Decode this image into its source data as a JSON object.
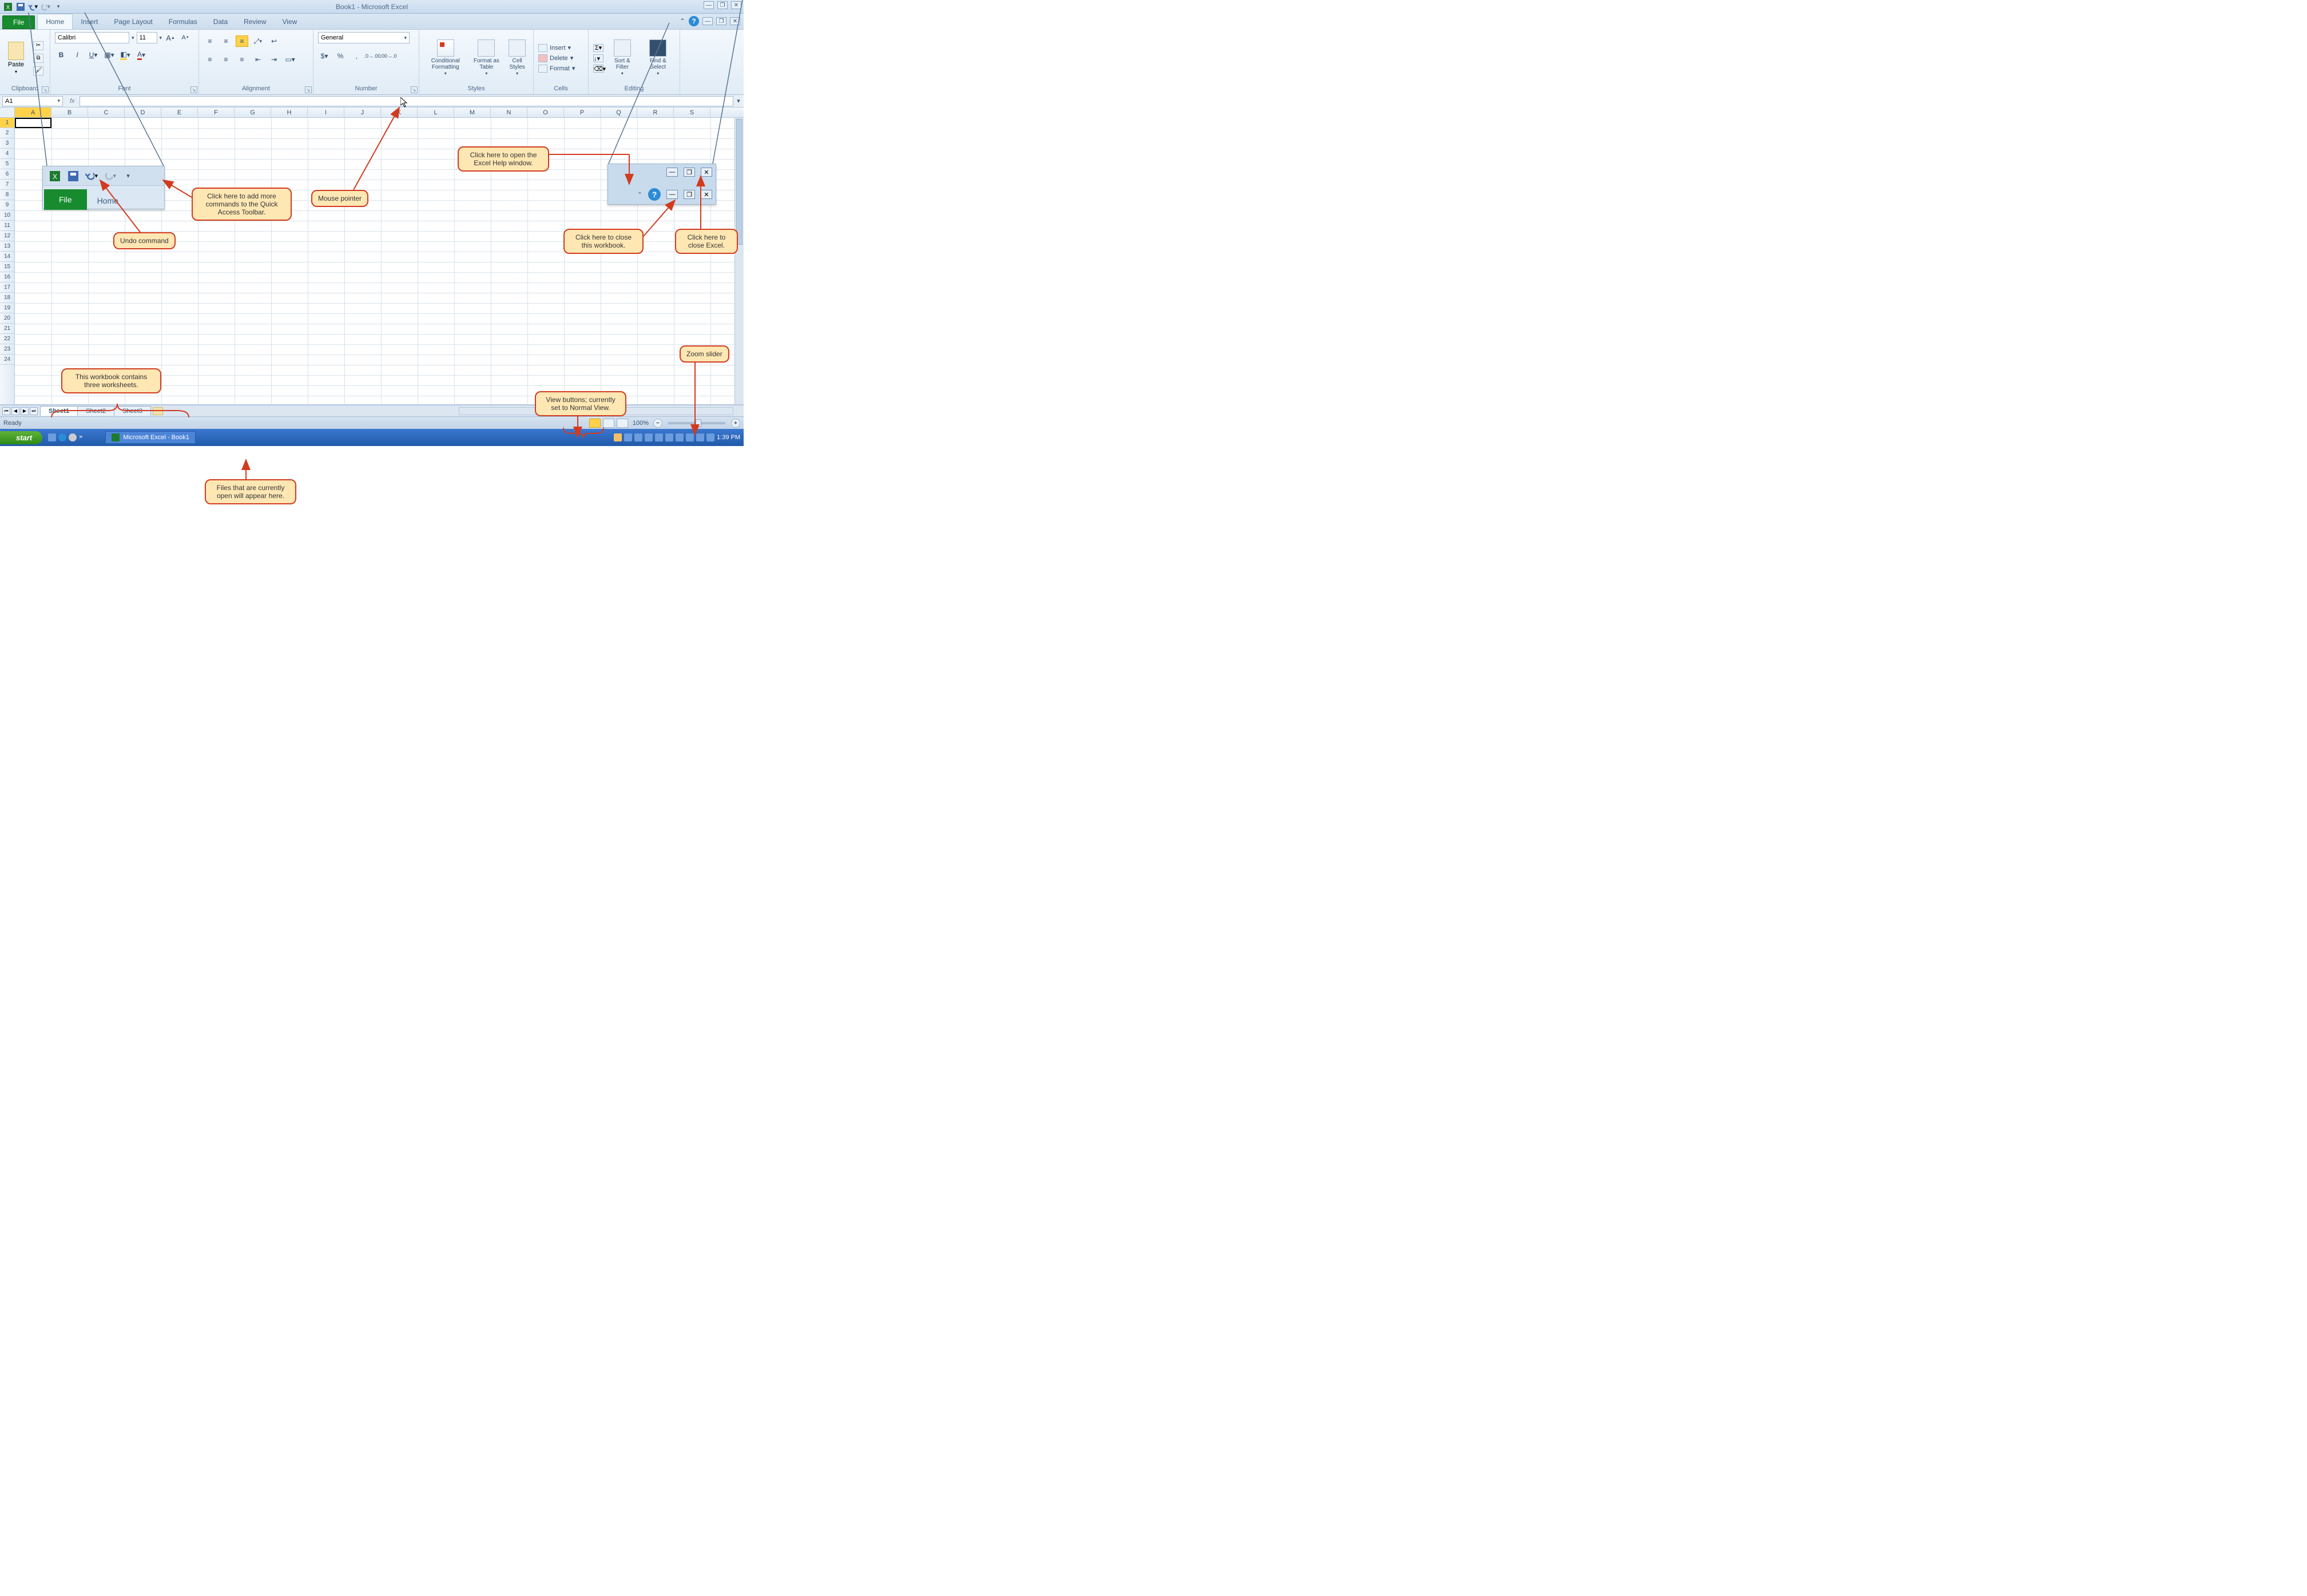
{
  "window": {
    "title": "Book1 - Microsoft Excel"
  },
  "qat_icons": [
    "excel-icon",
    "save-icon",
    "undo-icon",
    "redo-icon",
    "customize-qat-icon"
  ],
  "ribbon": {
    "tabs": [
      "File",
      "Home",
      "Insert",
      "Page Layout",
      "Formulas",
      "Data",
      "Review",
      "View"
    ],
    "active_tab": "Home",
    "groups": {
      "clipboard": {
        "label": "Clipboard",
        "paste": "Paste"
      },
      "font": {
        "label": "Font",
        "font_name": "Calibri",
        "font_size": "11"
      },
      "alignment": {
        "label": "Alignment"
      },
      "number": {
        "label": "Number",
        "format": "General"
      },
      "styles": {
        "label": "Styles",
        "cond": "Conditional Formatting",
        "table": "Format as Table",
        "cell": "Cell Styles"
      },
      "cells": {
        "label": "Cells",
        "insert": "Insert",
        "delete": "Delete",
        "format": "Format"
      },
      "editing": {
        "label": "Editing",
        "sort": "Sort & Filter",
        "find": "Find & Select"
      }
    }
  },
  "formula_bar": {
    "name_box": "A1",
    "fx_label": "fx",
    "formula": ""
  },
  "grid": {
    "columns": [
      "A",
      "B",
      "C",
      "D",
      "E",
      "F",
      "G",
      "H",
      "I",
      "J",
      "K",
      "L",
      "M",
      "N",
      "O",
      "P",
      "Q",
      "R",
      "S"
    ],
    "rows": [
      1,
      2,
      3,
      4,
      5,
      6,
      7,
      8,
      9,
      10,
      11,
      12,
      13,
      14,
      15,
      16,
      17,
      18,
      19,
      20,
      21,
      22,
      23,
      24
    ],
    "active_cell": "A1"
  },
  "sheets": {
    "tabs": [
      "Sheet1",
      "Sheet2",
      "Sheet3"
    ],
    "active": "Sheet1"
  },
  "statusbar": {
    "status": "Ready",
    "zoom": "100%"
  },
  "taskbar": {
    "start": "start",
    "task": "Microsoft Excel - Book1",
    "clock": "1:39 PM"
  },
  "callouts": {
    "qat_more": "Click here to add more commands to the Quick Access Toolbar.",
    "undo": "Undo command",
    "mouse": "Mouse pointer",
    "help": "Click here to open the Excel Help window.",
    "close_wb": "Click here to close this workbook.",
    "close_app": "Click here to close Excel.",
    "zoom_slider": "Zoom slider",
    "view_btns": "View buttons; currently set to Normal View.",
    "worksheets": "This workbook contains three worksheets.",
    "open_files": "Files that are currently open will appear here."
  },
  "zoom_inset": {
    "file": "File",
    "home": "Home"
  }
}
